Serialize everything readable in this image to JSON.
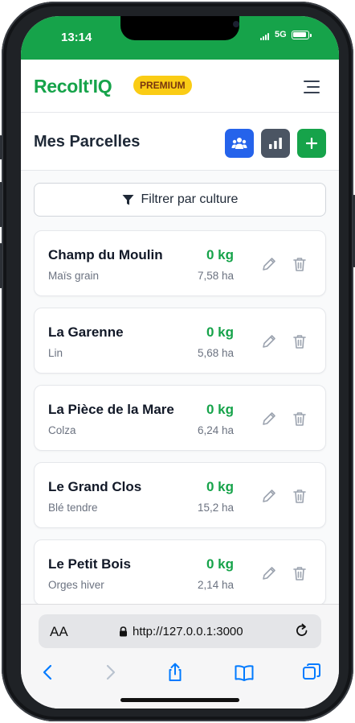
{
  "status": {
    "time": "13:14",
    "network": "5G"
  },
  "app": {
    "brand": "Recolt'IQ",
    "badge": "PREMIUM"
  },
  "page": {
    "title": "Mes Parcelles"
  },
  "actions": {
    "team_color": "#2563eb",
    "stats_color": "#4b5563",
    "add_color": "#16a34a"
  },
  "filter": {
    "label": "Filtrer par culture"
  },
  "parcels": [
    {
      "name": "Champ du Moulin",
      "crop": "Maïs grain",
      "yield": "0 kg",
      "area": "7,58 ha"
    },
    {
      "name": "La Garenne",
      "crop": "Lin",
      "yield": "0 kg",
      "area": "5,68 ha"
    },
    {
      "name": "La Pièce de la Mare",
      "crop": "Colza",
      "yield": "0 kg",
      "area": "6,24 ha"
    },
    {
      "name": "Le Grand Clos",
      "crop": "Blé tendre",
      "yield": "0 kg",
      "area": "15,2 ha"
    },
    {
      "name": "Le Petit Bois",
      "crop": "Orges hiver",
      "yield": "0 kg",
      "area": "2,14 ha"
    }
  ],
  "browser": {
    "text_size": "AA",
    "url": "http://127.0.0.1:3000"
  },
  "colors": {
    "brand_green": "#16a34a",
    "badge_yellow": "#facc15",
    "ios_blue": "#007aff"
  }
}
